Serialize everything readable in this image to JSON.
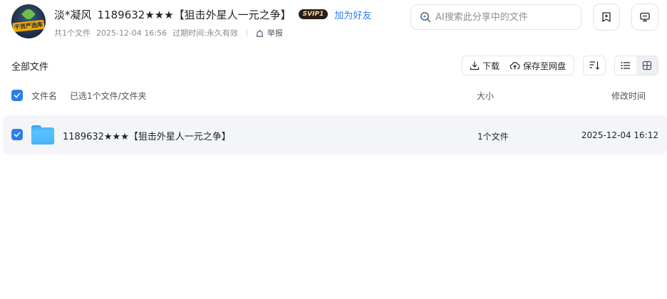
{
  "header": {
    "avatar_text": "干货严选库",
    "username": "淡*凝风",
    "file_title": "1189632★★★【狙击外星人一元之争】",
    "vip_badge": "SVIP1",
    "add_friend": "加为好友",
    "meta": {
      "file_count": "共1个文件",
      "created": "2025-12-04 16:56",
      "expiry_label": "过期时间:",
      "expiry_value": "永久有效",
      "report": "举报"
    },
    "search_placeholder": "AI搜索此分享中的文件"
  },
  "toolbar": {
    "section_title": "全部文件",
    "download": "下载",
    "save": "保存至网盘"
  },
  "table": {
    "columns": {
      "name": "文件名",
      "selection": "已选1个文件/文件夹",
      "size": "大小",
      "modified": "修改时间"
    },
    "rows": [
      {
        "name": "1189632★★★【狙击外星人一元之争】",
        "size": "1个文件",
        "modified": "2025-12-04 16:12",
        "selected": true,
        "icon": "folder-icon"
      }
    ]
  },
  "colors": {
    "accent": "#2b7df2",
    "row_bg": "#f4f5f8",
    "folder": "#4db8fa"
  }
}
